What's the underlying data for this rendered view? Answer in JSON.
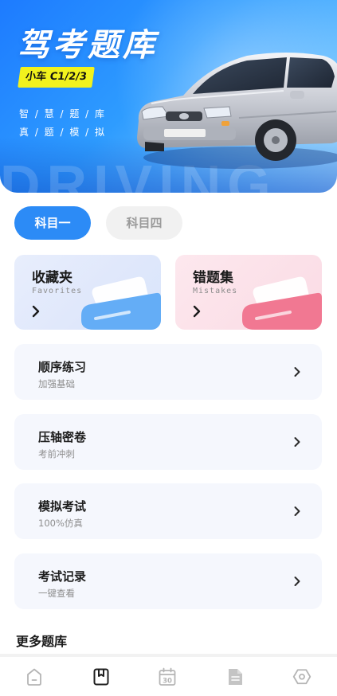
{
  "banner": {
    "title": "驾考题库",
    "tag": "小车 C1/2/3",
    "sub_line1": "智 / 慧 / 题 / 库",
    "sub_line2": "真 / 题 / 模 / 拟",
    "watermark": "DRIVING"
  },
  "tabs": [
    {
      "label": "科目一",
      "active": true
    },
    {
      "label": "科目四",
      "active": false
    }
  ],
  "cards": {
    "favorites": {
      "title": "收藏夹",
      "subtitle": "Favorites"
    },
    "mistakes": {
      "title": "错题集",
      "subtitle": "Mistakes"
    }
  },
  "practice_items": [
    {
      "title": "顺序练习",
      "subtitle": "加强基础"
    },
    {
      "title": "压轴密卷",
      "subtitle": "考前冲刺"
    },
    {
      "title": "模拟考试",
      "subtitle": "100%仿真"
    },
    {
      "title": "考试记录",
      "subtitle": "一键查看"
    }
  ],
  "more_section": {
    "title": "更多题库"
  },
  "bottom_nav": {
    "items": [
      {
        "icon": "home-icon",
        "active": false
      },
      {
        "icon": "bookmark-book-icon",
        "active": true
      },
      {
        "icon": "calendar-30-icon",
        "active": false
      },
      {
        "icon": "document-icon",
        "active": false
      },
      {
        "icon": "settings-hexagon-icon",
        "active": false
      }
    ],
    "calendar_day": "30"
  },
  "colors": {
    "accent": "#2c8bf6",
    "banner_tag_bg": "#f2f21d",
    "favorites_deco": "#5aa6f5",
    "mistakes_deco": "#f0708e"
  }
}
